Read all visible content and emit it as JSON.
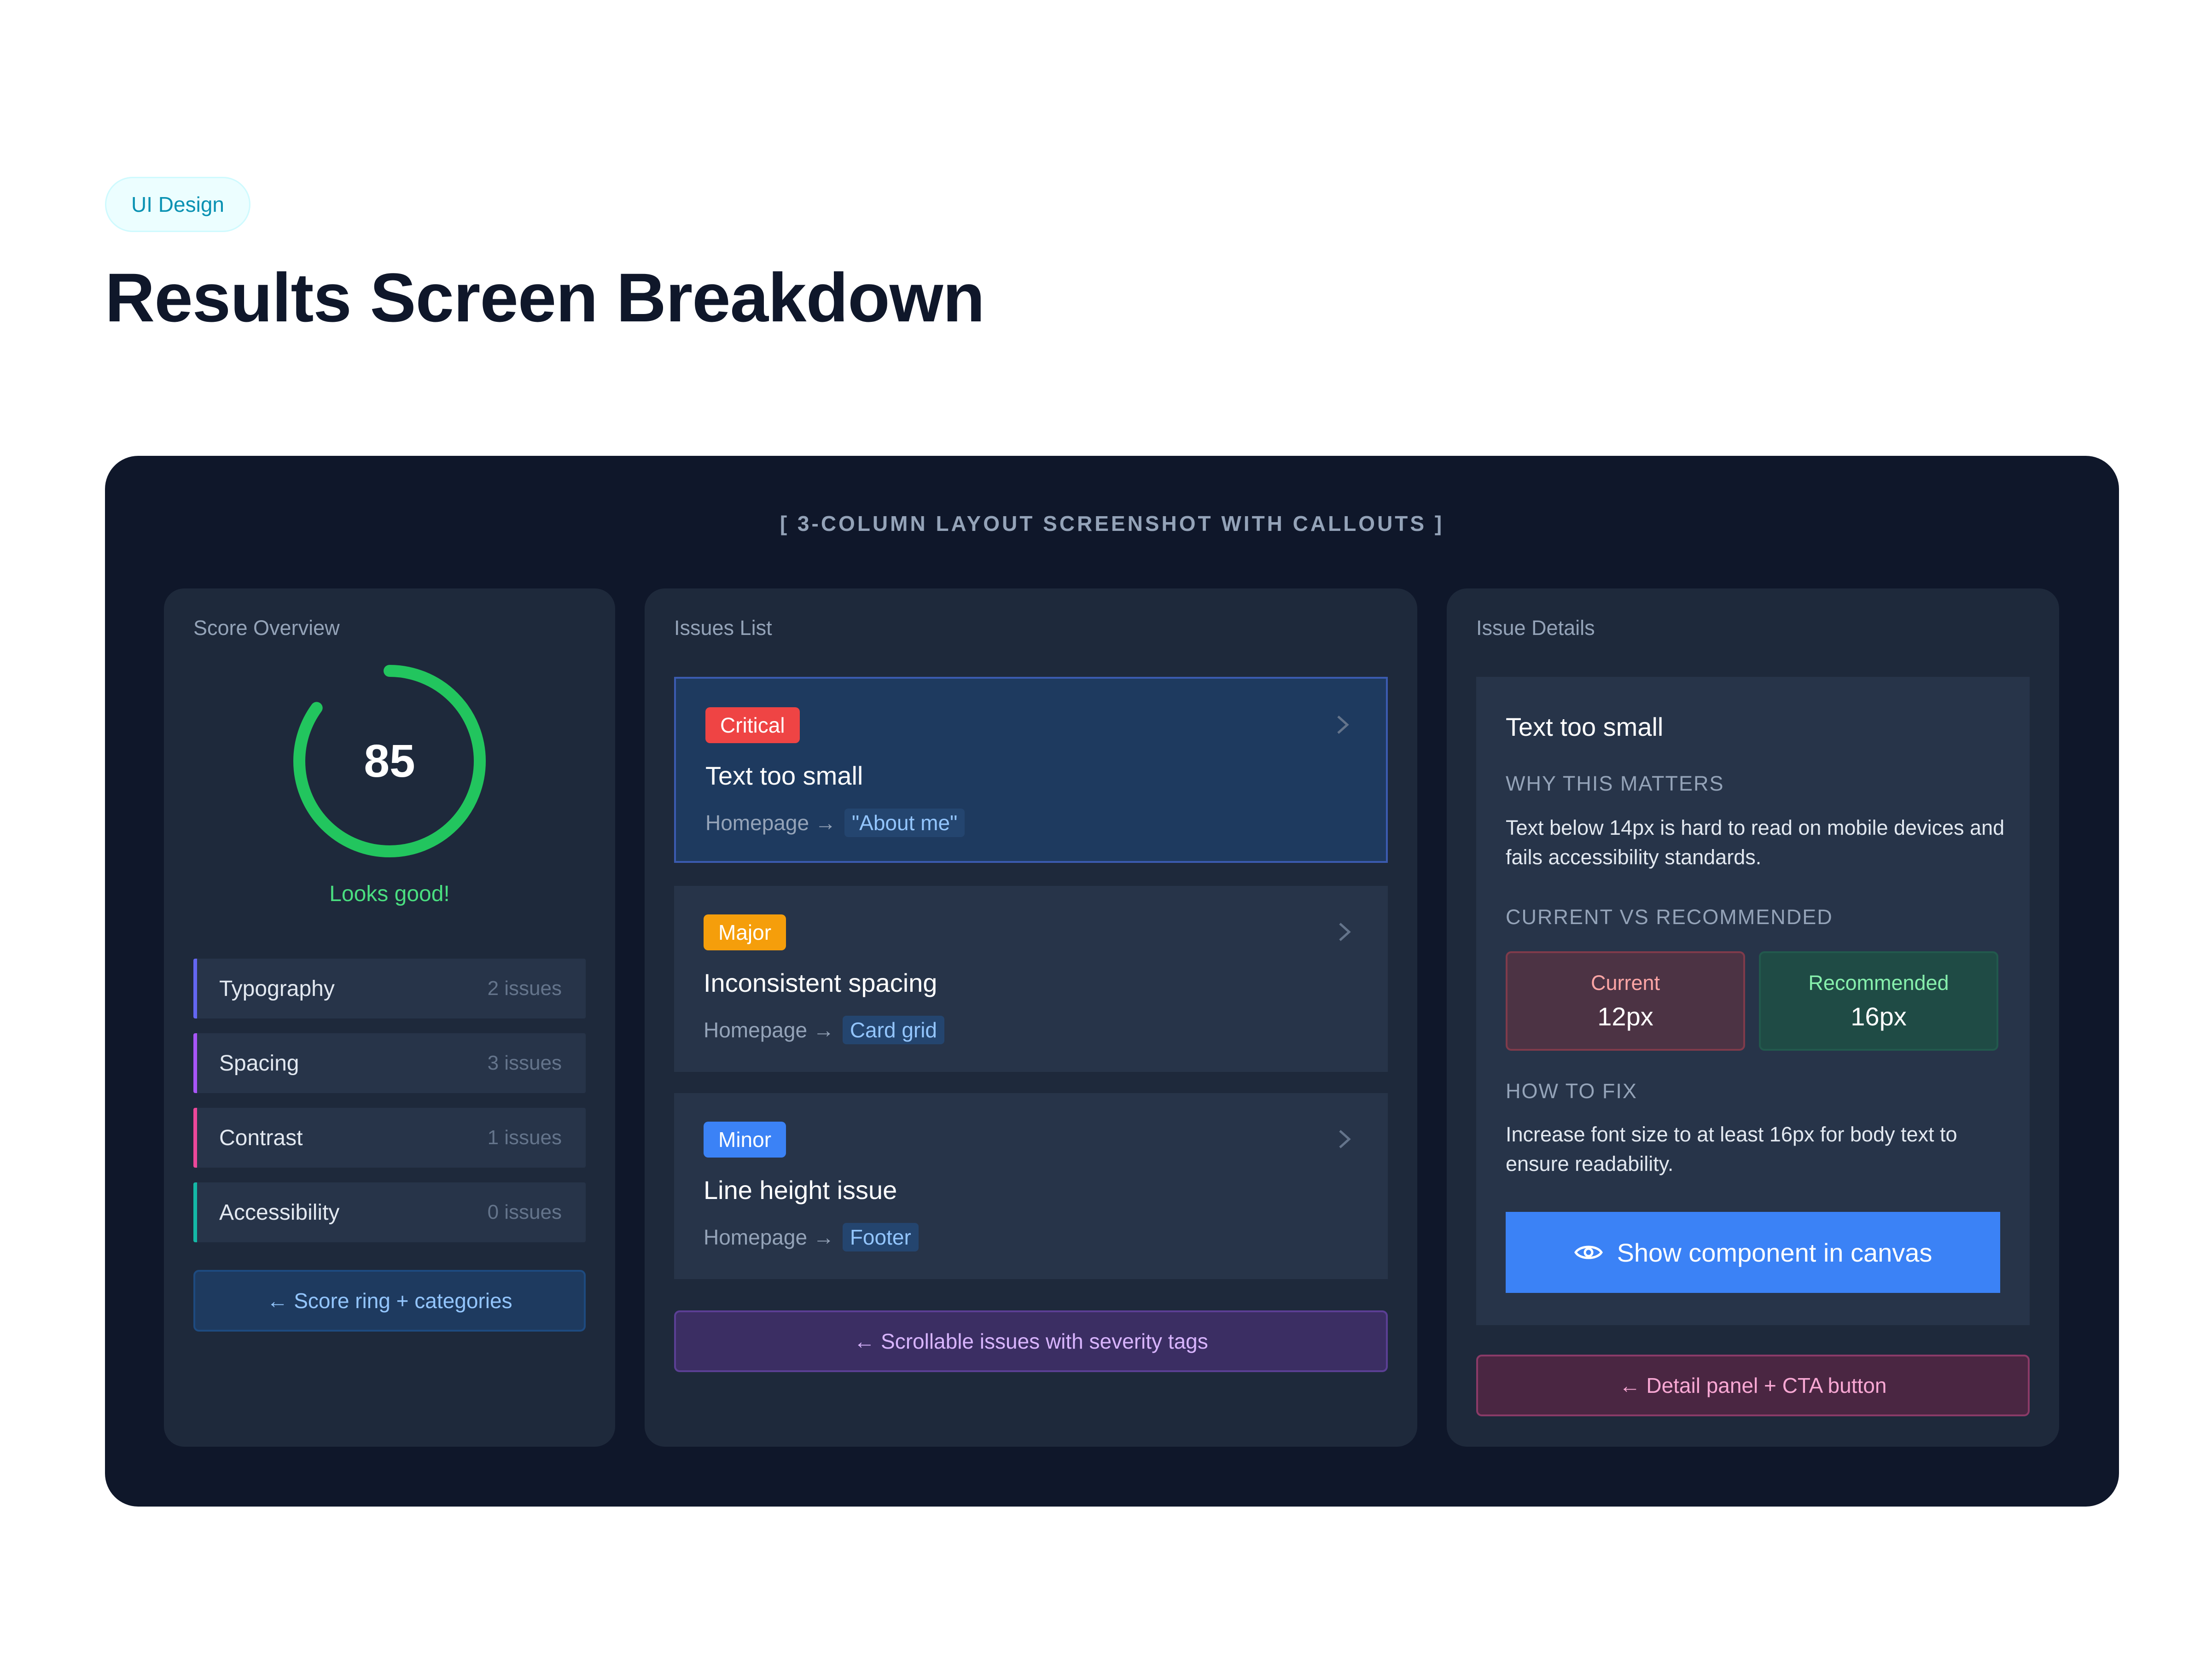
{
  "header": {
    "tag": "UI Design",
    "title": "Results Screen Breakdown"
  },
  "frame": {
    "caption": "[ 3-COLUMN LAYOUT SCREENSHOT WITH CALLOUTS ]"
  },
  "score_panel": {
    "title": "Score Overview",
    "score": "85",
    "score_value": 85,
    "score_max": 100,
    "status": "Looks good!",
    "categories": [
      {
        "name": "Typography",
        "count": "2 issues",
        "color": "#6366f1"
      },
      {
        "name": "Spacing",
        "count": "3 issues",
        "color": "#a855f7"
      },
      {
        "name": "Contrast",
        "count": "1 issues",
        "color": "#ec4899"
      },
      {
        "name": "Accessibility",
        "count": "0 issues",
        "color": "#14b8a6"
      }
    ],
    "callout": "← Score ring + categories"
  },
  "issues_panel": {
    "title": "Issues List",
    "items": [
      {
        "severity": "Critical",
        "severity_color": "#ef4444",
        "title": "Text too small",
        "page": "Homepage →",
        "component": "\"About me\""
      },
      {
        "severity": "Major",
        "severity_color": "#f59e0b",
        "title": "Inconsistent spacing",
        "page": "Homepage →",
        "component": "Card grid"
      },
      {
        "severity": "Minor",
        "severity_color": "#3b82f6",
        "title": "Line height issue",
        "page": "Homepage →",
        "component": "Footer"
      }
    ],
    "callout": "← Scrollable issues with severity tags"
  },
  "details_panel": {
    "title": "Issue Details",
    "issue_title": "Text too small",
    "why_heading": "WHY THIS MATTERS",
    "why_text": "Text below 14px is hard to read on mobile devices and fails accessibility standards.",
    "compare_heading": "CURRENT VS RECOMMENDED",
    "current_label": "Current",
    "current_value": "12px",
    "recommended_label": "Recommended",
    "recommended_value": "16px",
    "fix_heading": "HOW TO FIX",
    "fix_text": "Increase font size to at least 16px for body text to ensure readability.",
    "cta_label": "Show component in canvas",
    "cta_icon": "eye-icon",
    "callout": "← Detail panel + CTA button"
  }
}
